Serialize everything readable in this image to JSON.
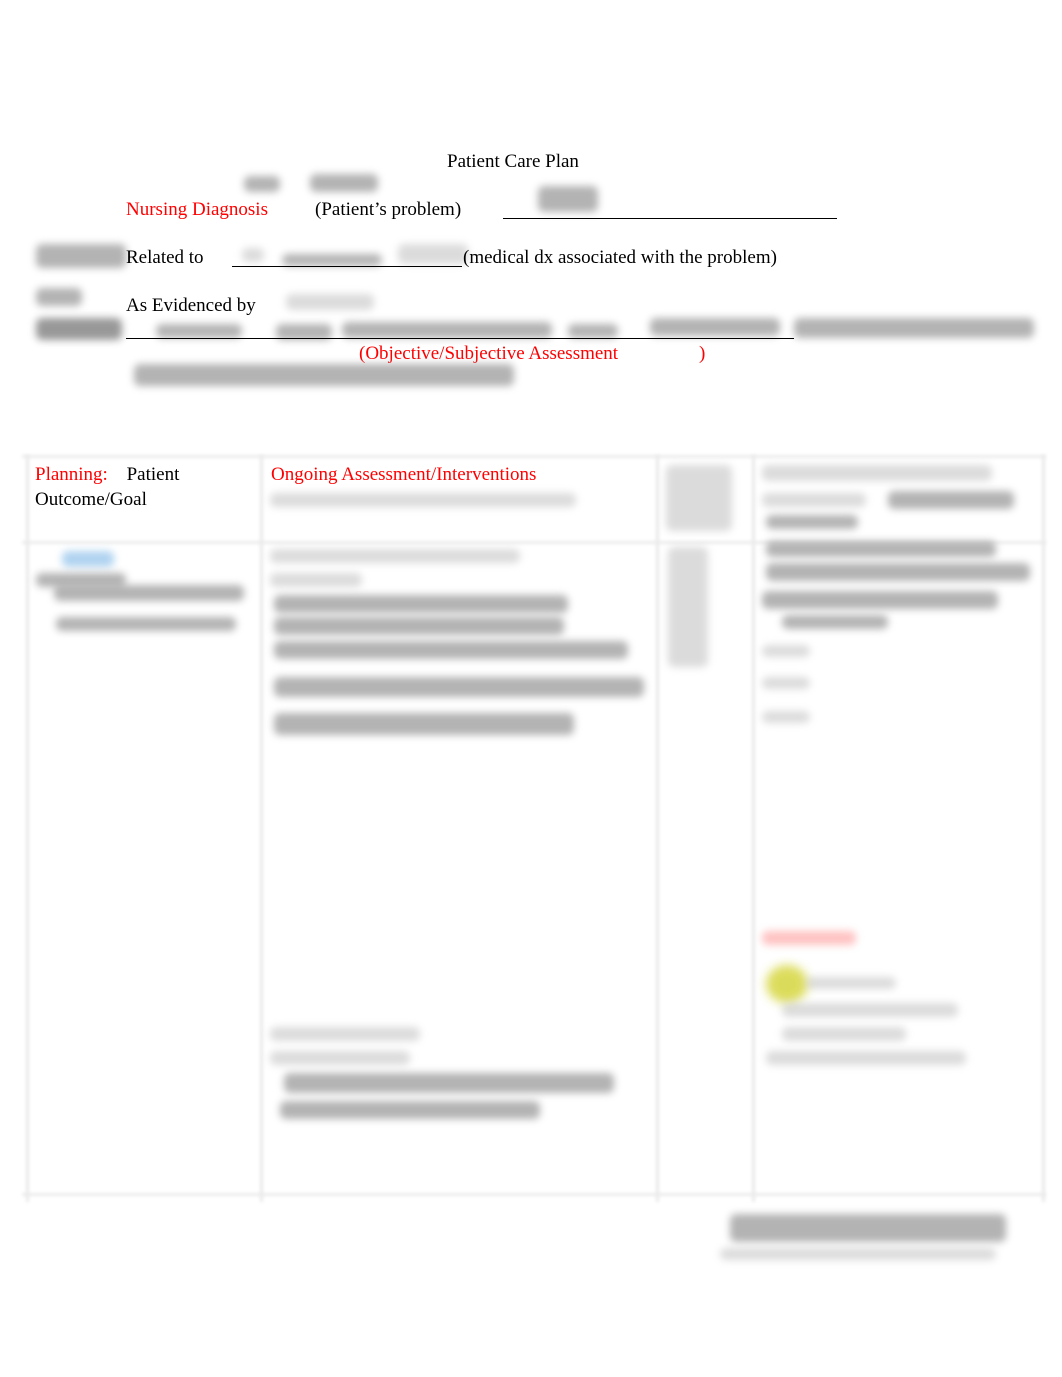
{
  "document": {
    "title": "Patient Care Plan",
    "nursing_diagnosis": {
      "label": "Nursing Diagnosis",
      "hint": "(Patient’s problem)"
    },
    "related_to": {
      "label": "Related to",
      "hint": "(medical dx associated with the problem)"
    },
    "as_evidenced_by": {
      "label": "As Evidenced by",
      "hint_open": "(Objective/Subjective Assessment",
      "hint_close": ")"
    },
    "table": {
      "headers": {
        "planning_label": "Planning:",
        "planning_rest": "Patient",
        "planning_line2": "Outcome/Goal",
        "ongoing": "Ongoing Assessment/Interventions"
      }
    }
  },
  "colors": {
    "accent_red": "#ff0000",
    "text": "#000000"
  }
}
